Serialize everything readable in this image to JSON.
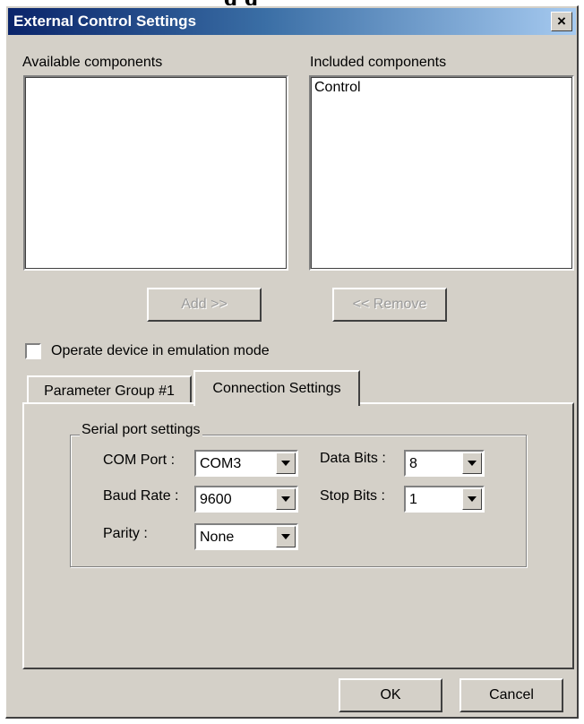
{
  "window": {
    "title": "External Control Settings",
    "close_glyph": "×",
    "top_clip_text": "g  g"
  },
  "components": {
    "available_label": "Available components",
    "available_items": [],
    "included_label": "Included components",
    "included_items": [
      "Control"
    ],
    "add_label": "Add >>",
    "remove_label": "<< Remove"
  },
  "emulation": {
    "label": "Operate device in emulation mode",
    "checked": false
  },
  "tabs": [
    {
      "label": "Parameter Group #1",
      "active": false
    },
    {
      "label": "Connection Settings",
      "active": true
    }
  ],
  "serial": {
    "group_title": "Serial port settings",
    "com_port_label": "COM Port :",
    "com_port_value": "COM3",
    "baud_rate_label": "Baud Rate :",
    "baud_rate_value": "9600",
    "parity_label": "Parity :",
    "parity_value": "None",
    "data_bits_label": "Data Bits :",
    "data_bits_value": "8",
    "stop_bits_label": "Stop Bits :",
    "stop_bits_value": "1"
  },
  "footer": {
    "ok_label": "OK",
    "cancel_label": "Cancel"
  },
  "icons": {
    "close": "close-icon",
    "dropdown": "chevron-down-icon"
  }
}
